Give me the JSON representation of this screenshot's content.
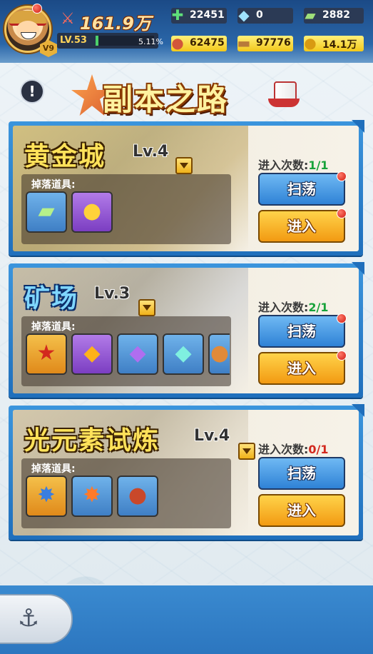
{
  "header": {
    "power": "161.9万",
    "level": "LV.53",
    "exp_fraction": 0.0511,
    "exp_percent": "5.11%",
    "vip": "V9",
    "resources": [
      {
        "icon": "stamina-potion-icon",
        "value": "22451"
      },
      {
        "icon": "diamond-icon",
        "value": "0"
      },
      {
        "icon": "banknote-icon",
        "value": "2882"
      },
      {
        "icon": "meat-icon",
        "value": "62475"
      },
      {
        "icon": "wood-log-icon",
        "value": "97776"
      },
      {
        "icon": "gold-coin-icon",
        "value": "14.1万"
      }
    ]
  },
  "title": "副本之路",
  "drop_label": "掉落道具:",
  "entry_label": "进入次数:",
  "buttons": {
    "sweep": "扫荡",
    "enter": "进入"
  },
  "dungeons": [
    {
      "name": "黄金城",
      "level": "Lv.4",
      "entries": "1/1",
      "items": [
        "banknote-icon",
        "gold-coin-icon"
      ]
    },
    {
      "name": "矿场",
      "level": "Lv.3",
      "entries": "2/1",
      "items": [
        "red-star-gem-icon",
        "amber-gem-icon",
        "purple-crystal-icon",
        "teal-crystal-icon",
        "partial-item-icon"
      ]
    },
    {
      "name": "光元素试炼",
      "level": "Lv.4",
      "entries": "0/1",
      "items": [
        "light-orb-blue-icon",
        "light-orb-orange-icon",
        "meat-icon"
      ]
    }
  ],
  "colors": {
    "accent_blue": "#2f82d6",
    "accent_orange": "#f29a12",
    "count_green": "#17a23a",
    "count_red": "#d2281e"
  }
}
